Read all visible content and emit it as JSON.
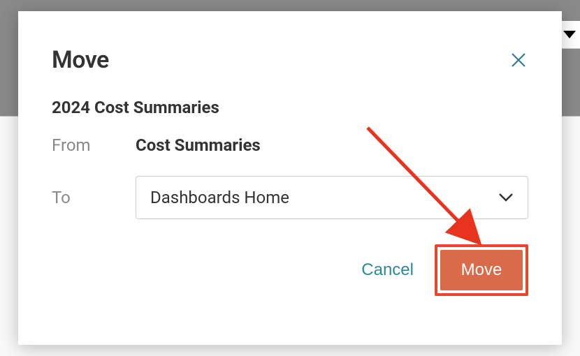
{
  "modal": {
    "title": "Move",
    "item_name": "2024 Cost Summaries",
    "from_label": "From",
    "from_value": "Cost Summaries",
    "to_label": "To",
    "to_selected": "Dashboards Home",
    "cancel_label": "Cancel",
    "move_label": "Move"
  }
}
